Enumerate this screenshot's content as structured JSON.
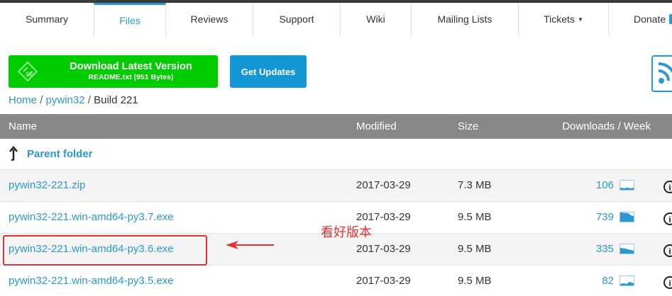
{
  "tabs": [
    {
      "label": "Summary",
      "active": false
    },
    {
      "label": "Files",
      "active": true
    },
    {
      "label": "Reviews",
      "active": false
    },
    {
      "label": "Support",
      "active": false
    },
    {
      "label": "Wiki",
      "active": false
    },
    {
      "label": "Mailing Lists",
      "active": false
    },
    {
      "label": "Tickets",
      "active": false,
      "dropdown": true
    },
    {
      "label": "Donate",
      "active": false
    }
  ],
  "actions": {
    "download_title": "Download Latest Version",
    "download_sub": "README.txt (951 Bytes)",
    "updates_label": "Get Updates",
    "download_color": "#00cc00",
    "updates_color": "#1497d4",
    "rss_icon": "rss-icon"
  },
  "breadcrumb": {
    "home": "Home",
    "project": "pywin32",
    "current": "Build 221",
    "separator": "/"
  },
  "table": {
    "columns": {
      "name": "Name",
      "modified": "Modified",
      "size": "Size",
      "downloads": "Downloads / Week"
    },
    "parent_folder": "Parent folder",
    "rows": [
      {
        "name": "pywin32-221.zip",
        "modified": "2017-03-29",
        "size": "7.3 MB",
        "downloads": "106"
      },
      {
        "name": "pywin32-221.win-amd64-py3.7.exe",
        "modified": "2017-03-29",
        "size": "9.5 MB",
        "downloads": "739"
      },
      {
        "name": "pywin32-221.win-amd64-py3.6.exe",
        "modified": "2017-03-29",
        "size": "9.5 MB",
        "downloads": "335"
      },
      {
        "name": "pywin32-221.win-amd64-py3.5.exe",
        "modified": "2017-03-29",
        "size": "9.5 MB",
        "downloads": "82"
      }
    ]
  },
  "annotation": {
    "text": "看好版本",
    "color": "#e53333"
  },
  "colors": {
    "link": "#2a98d3",
    "header_bg": "#888888"
  }
}
